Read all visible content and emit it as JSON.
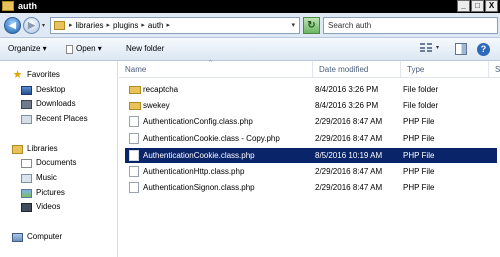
{
  "window": {
    "title": "auth",
    "controls": {
      "minimize": "_",
      "maximize": "□",
      "close": "X"
    }
  },
  "address": {
    "crumbs": [
      "libraries",
      "plugins",
      "auth"
    ],
    "separator": "▸",
    "dropdown": "▾",
    "refresh": "↻",
    "search_placeholder": "Search auth"
  },
  "toolbar": {
    "organize_label": "Organize ▾",
    "open_label": "Open ▾",
    "new_folder_label": "New folder",
    "help_label": "?",
    "view_dropdown": "▾"
  },
  "nav": {
    "favorites": "Favorites",
    "desktop": "Desktop",
    "downloads": "Downloads",
    "recent": "Recent Places",
    "libraries": "Libraries",
    "documents": "Documents",
    "music": "Music",
    "pictures": "Pictures",
    "videos": "Videos",
    "computer": "Computer"
  },
  "columns": {
    "name": "Name",
    "date": "Date modified",
    "type": "Type",
    "size": "Si",
    "sort": "^"
  },
  "files": [
    {
      "name": "recaptcha",
      "date": "8/4/2016 3:26 PM",
      "type": "File folder",
      "kind": "folder"
    },
    {
      "name": "swekey",
      "date": "8/4/2016 3:26 PM",
      "type": "File folder",
      "kind": "folder"
    },
    {
      "name": "AuthenticationConfig.class.php",
      "date": "2/29/2016 8:47 AM",
      "type": "PHP File",
      "kind": "file"
    },
    {
      "name": "AuthenticationCookie.class - Copy.php",
      "date": "2/29/2016 8:47 AM",
      "type": "PHP File",
      "kind": "file"
    },
    {
      "name": "AuthenticationCookie.class.php",
      "date": "8/5/2016 10:19 AM",
      "type": "PHP File",
      "kind": "file",
      "selected": true
    },
    {
      "name": "AuthenticationHttp.class.php",
      "date": "2/29/2016 8:47 AM",
      "type": "PHP File",
      "kind": "file"
    },
    {
      "name": "AuthenticationSignon.class.php",
      "date": "2/29/2016 8:47 AM",
      "type": "PHP File",
      "kind": "file"
    }
  ],
  "colors": {
    "selection": "#0a246a",
    "titlebar": "#000000",
    "folder": "#e9c25a"
  }
}
